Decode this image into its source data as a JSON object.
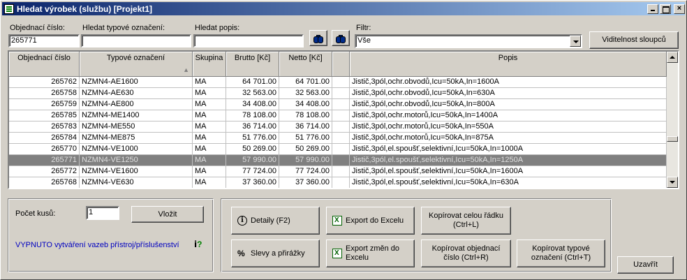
{
  "window": {
    "title": "Hledat výrobek (službu) [Projekt1]"
  },
  "search": {
    "order_label": "Objednací číslo:",
    "order_value": "265771",
    "type_label": "Hledat typové označení:",
    "type_value": "",
    "desc_label": "Hledat popis:",
    "desc_value": "",
    "filter_label": "Filtr:",
    "filter_value": "Vše",
    "visibility_button": "Viditelnost sloupců"
  },
  "grid": {
    "headers": [
      "Objednací číslo",
      "Typové označení",
      "Skupina",
      "Brutto  [Kč]",
      "Netto  [Kč]",
      "",
      "Popis"
    ],
    "rows": [
      [
        "265762",
        "NZMN4-AE1600",
        "MA",
        "64 701.00",
        "64 701.00",
        "",
        "Jistič,3pól,ochr.obvodů,Icu=50kA,In=1600A"
      ],
      [
        "265758",
        "NZMN4-AE630",
        "MA",
        "32 563.00",
        "32 563.00",
        "",
        "Jistič,3pól,ochr.obvodů,Icu=50kA,In=630A"
      ],
      [
        "265759",
        "NZMN4-AE800",
        "MA",
        "34 408.00",
        "34 408.00",
        "",
        "Jistič,3pól,ochr.obvodů,Icu=50kA,In=800A"
      ],
      [
        "265785",
        "NZMN4-ME1400",
        "MA",
        "78 108.00",
        "78 108.00",
        "",
        "Jistič,3pól,ochr.motorů,Icu=50kA,In=1400A"
      ],
      [
        "265783",
        "NZMN4-ME550",
        "MA",
        "36 714.00",
        "36 714.00",
        "",
        "Jistič,3pól,ochr.motorů,Icu=50kA,In=550A"
      ],
      [
        "265784",
        "NZMN4-ME875",
        "MA",
        "51 776.00",
        "51 776.00",
        "",
        "Jistič,3pól,ochr.motorů,Icu=50kA,In=875A"
      ],
      [
        "265770",
        "NZMN4-VE1000",
        "MA",
        "50 269.00",
        "50 269.00",
        "",
        "Jistič,3pól,el.spoušť,selektivní,Icu=50kA,In=1000A"
      ],
      [
        "265771",
        "NZMN4-VE1250",
        "MA",
        "57 990.00",
        "57 990.00",
        "",
        "Jistič,3pól,el.spoušť,selektivní,Icu=50kA,In=1250A"
      ],
      [
        "265772",
        "NZMN4-VE1600",
        "MA",
        "77 724.00",
        "77 724.00",
        "",
        "Jistič,3pól,el.spoušť,selektivní,Icu=50kA,In=1600A"
      ],
      [
        "265768",
        "NZMN4-VE630",
        "MA",
        "37 360.00",
        "37 360.00",
        "",
        "Jistič,3pól,el.spoušť,selektivní,Icu=50kA,In=630A"
      ]
    ],
    "selected_row": 7
  },
  "quantity": {
    "label": "Počet kusů:",
    "value": "1",
    "insert_button": "Vložit",
    "link_text": "VYPNUTO vytváření vazeb přístroj/příslušenství"
  },
  "actions": {
    "details": "Detaily (F2)",
    "export_excel": "Export do Excelu",
    "copy_row_1": "Kopírovat celou řádku",
    "copy_row_2": "(Ctrl+L)",
    "discounts": "Slevy a přirážky",
    "export_changes_1": "Export změn do",
    "export_changes_2": "Excelu",
    "copy_order_1": "Kopírovat objednací",
    "copy_order_2": "číslo (Ctrl+R)",
    "copy_type_1": "Kopírovat typové",
    "copy_type_2": "označení (Ctrl+T)",
    "close": "Uzavřít"
  },
  "icons": {
    "app": "app-icon",
    "search1": "binoculars-icon",
    "search2": "binoculars-icon",
    "details": "info-icon",
    "excel": "excel-icon",
    "discount": "percent-icon",
    "help": "help-icon"
  }
}
